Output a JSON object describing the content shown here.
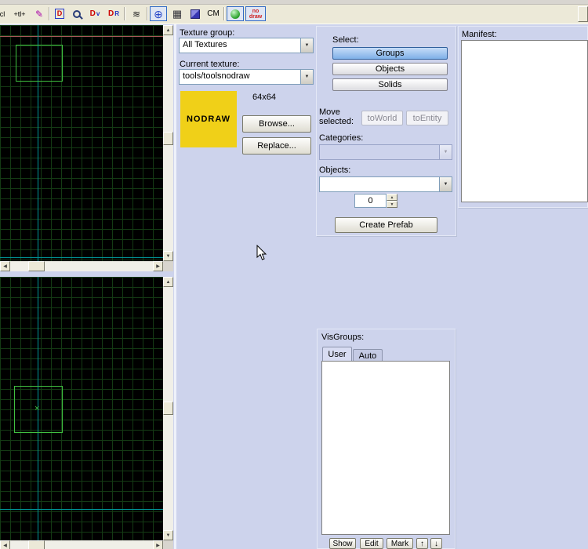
{
  "toolbar": {
    "icons": [
      {
        "name": "clip-tool",
        "text": "cl"
      },
      {
        "name": "transform-tool",
        "text": "+tl+"
      },
      {
        "name": "pencil-tool",
        "text": "✎"
      },
      {
        "name": "texture-application-tool",
        "text": "D"
      },
      {
        "name": "zoom-tool",
        "text": ""
      },
      {
        "name": "dv-tool",
        "text": "D",
        "sub": "v"
      },
      {
        "name": "dr-tool",
        "text": "D",
        "sub": "R"
      },
      {
        "name": "displacement-tool",
        "text": "≋"
      },
      {
        "name": "compass-toggle",
        "text": "⊕"
      },
      {
        "name": "grid-toggle",
        "text": "▦"
      },
      {
        "name": "cube-toggle",
        "text": ""
      },
      {
        "name": "cm-label",
        "text": "CM"
      },
      {
        "name": "smooth-toggle",
        "text": ""
      },
      {
        "name": "nodraw-toggle",
        "line1": "no",
        "line2": "draw"
      }
    ]
  },
  "ui": {
    "scroll_up": "▲",
    "scroll_down": "▼",
    "scroll_left": "◀",
    "scroll_right": "▶",
    "combo_arrow": "▼",
    "spin_up": "▲",
    "spin_down": "▼",
    "cross_mark": "×"
  },
  "texture_panel": {
    "group_label": "Texture group:",
    "group_value": "All Textures",
    "current_label": "Current texture:",
    "current_value": "tools/toolsnodraw",
    "preview_text": "NODRAW",
    "size_text": "64x64",
    "browse_label": "Browse...",
    "replace_label": "Replace..."
  },
  "select_panel": {
    "select_label": "Select:",
    "buttons": [
      {
        "label": "Groups"
      },
      {
        "label": "Objects"
      },
      {
        "label": "Solids"
      }
    ],
    "move_label": "Move selected:",
    "to_world": "toWorld",
    "to_entity": "toEntity",
    "categories_label": "Categories:",
    "objects_label": "Objects:",
    "spinner_value": "0",
    "create_prefab": "Create Prefab"
  },
  "manifest_panel": {
    "label": "Manifest:"
  },
  "visgroups_panel": {
    "label": "VisGroups:",
    "tabs": [
      {
        "label": "User"
      },
      {
        "label": "Auto"
      }
    ],
    "show_label": "Show",
    "edit_label": "Edit",
    "mark_label": "Mark",
    "up_glyph": "↑",
    "down_glyph": "↓"
  }
}
